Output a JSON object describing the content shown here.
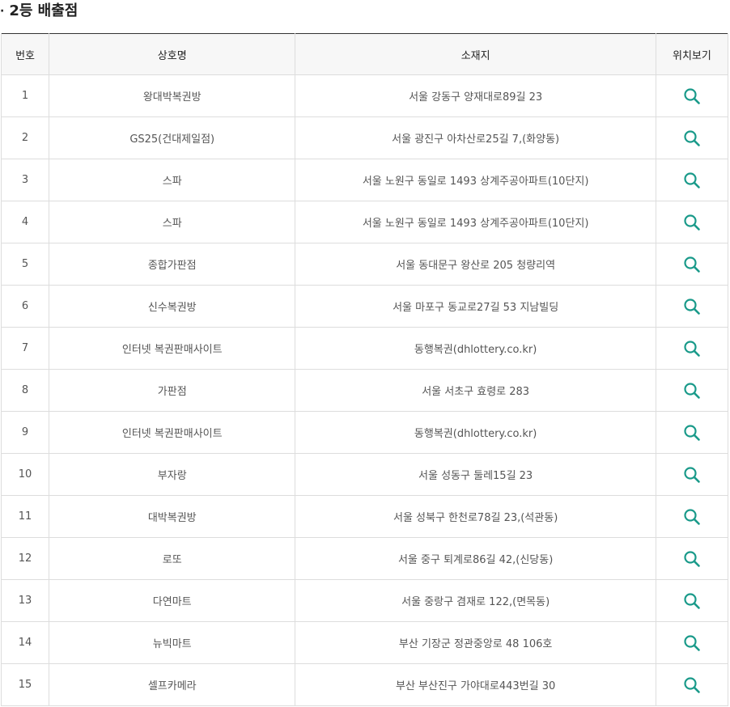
{
  "section": {
    "bullet": "·",
    "title": "2등 배출점"
  },
  "table": {
    "headers": {
      "no": "번호",
      "name": "상호명",
      "address": "소재지",
      "view": "위치보기"
    },
    "rows": [
      {
        "no": "1",
        "name": "왕대박복권방",
        "address": "서울 강동구 양재대로89길 23"
      },
      {
        "no": "2",
        "name": "GS25(건대제일점)",
        "address": "서울 광진구 아차산로25길 7,(화양동)"
      },
      {
        "no": "3",
        "name": "스파",
        "address": "서울 노원구 동일로 1493 상계주공아파트(10단지)"
      },
      {
        "no": "4",
        "name": "스파",
        "address": "서울 노원구 동일로 1493 상계주공아파트(10단지)"
      },
      {
        "no": "5",
        "name": "종합가판점",
        "address": "서울 동대문구 왕산로 205 청량리역"
      },
      {
        "no": "6",
        "name": "신수복권방",
        "address": "서울 마포구 동교로27길 53 지남빌딩"
      },
      {
        "no": "7",
        "name": "인터넷 복권판매사이트",
        "address": "동행복권(dhlottery.co.kr)"
      },
      {
        "no": "8",
        "name": "가판점",
        "address": "서울 서초구 효령로 283"
      },
      {
        "no": "9",
        "name": "인터넷 복권판매사이트",
        "address": "동행복권(dhlottery.co.kr)"
      },
      {
        "no": "10",
        "name": "부자랑",
        "address": "서울 성동구 둘레15길 23"
      },
      {
        "no": "11",
        "name": "대박복권방",
        "address": "서울 성북구 한천로78길 23,(석관동)"
      },
      {
        "no": "12",
        "name": "로또",
        "address": "서울 중구 퇴계로86길 42,(신당동)"
      },
      {
        "no": "13",
        "name": "다연마트",
        "address": "서울 중랑구 겸재로 122,(면목동)"
      },
      {
        "no": "14",
        "name": "뉴빅마트",
        "address": "부산 기장군 정관중앙로 48 106호"
      },
      {
        "no": "15",
        "name": "셀프카메라",
        "address": "부산 부산진구 가야대로443번길 30"
      }
    ]
  },
  "icons": {
    "view_icon": "search-icon",
    "accent_color": "#1a9a8a"
  }
}
